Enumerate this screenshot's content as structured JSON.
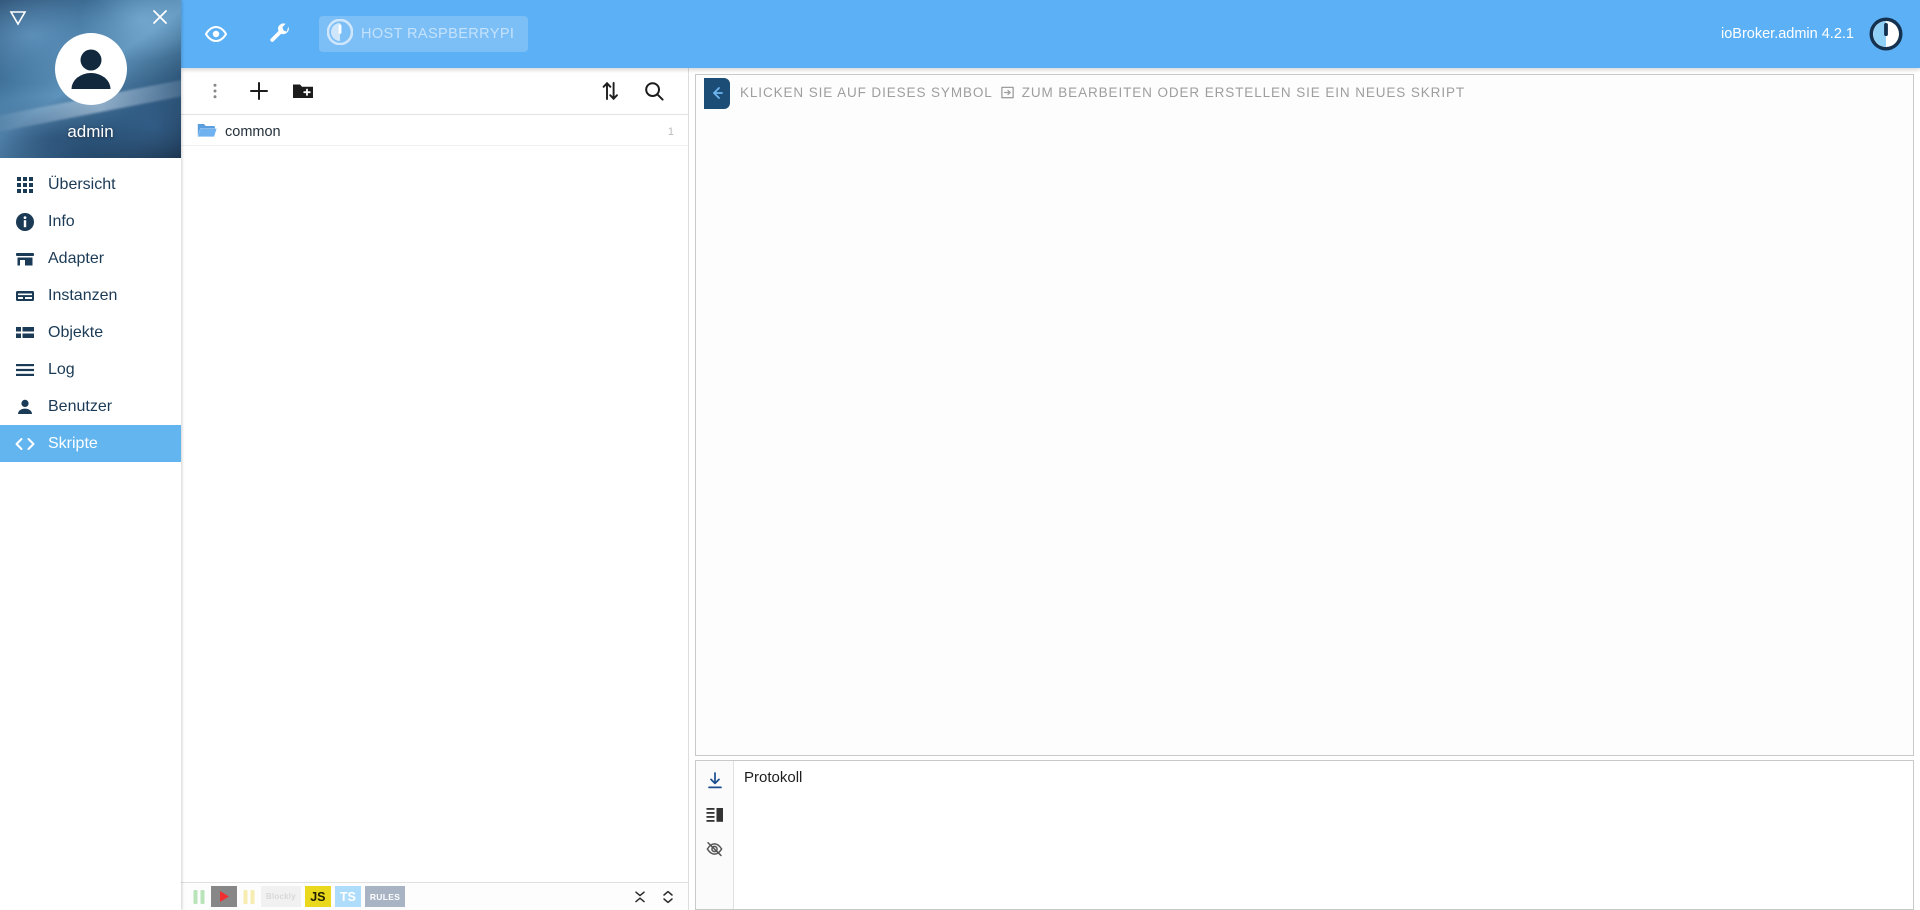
{
  "sidebar": {
    "username": "admin",
    "logo_icon": "iobroker-triangle-icon",
    "close_icon": "close-icon",
    "avatar_icon": "user-avatar-icon",
    "items": [
      {
        "label": "Übersicht",
        "icon": "apps-grid-icon",
        "active": false
      },
      {
        "label": "Info",
        "icon": "info-circle-icon",
        "active": false
      },
      {
        "label": "Adapter",
        "icon": "store-icon",
        "active": false
      },
      {
        "label": "Instanzen",
        "icon": "instances-icon",
        "active": false
      },
      {
        "label": "Objekte",
        "icon": "objects-list-icon",
        "active": false
      },
      {
        "label": "Log",
        "icon": "log-lines-icon",
        "active": false
      },
      {
        "label": "Benutzer",
        "icon": "person-icon",
        "active": false
      },
      {
        "label": "Skripte",
        "icon": "code-brackets-icon",
        "active": true
      }
    ]
  },
  "appbar": {
    "eye_icon": "eye-icon",
    "wrench_icon": "wrench-icon",
    "host_chip": {
      "label": "HOST RASPBERRYPI",
      "icon": "iobroker-logo-icon"
    },
    "version": "ioBroker.admin 4.2.1",
    "logo_icon": "iobroker-logo-icon"
  },
  "scripts_panel": {
    "toolbar": [
      {
        "name": "more-menu",
        "icon": "dots-vertical-icon"
      },
      {
        "name": "add-script",
        "icon": "plus-icon"
      },
      {
        "name": "new-folder",
        "icon": "folder-plus-icon"
      },
      {
        "name": "sort",
        "icon": "sort-arrows-icon"
      },
      {
        "name": "search",
        "icon": "search-icon"
      }
    ],
    "tree": [
      {
        "name": "common",
        "count": "1",
        "icon": "folder-open-icon"
      }
    ],
    "footer_filters": [
      {
        "name": "filter-paused-green",
        "icon": "pause-bars-green-icon",
        "label": ""
      },
      {
        "name": "filter-running",
        "icon": "play-triangle-icon",
        "label": ""
      },
      {
        "name": "filter-paused-yellow",
        "icon": "pause-bars-yellow-icon",
        "label": ""
      },
      {
        "name": "filter-blockly",
        "icon": "blockly-badge-icon",
        "label": "Blockly"
      },
      {
        "name": "filter-js",
        "icon": "js-badge-icon",
        "label": "JS"
      },
      {
        "name": "filter-ts",
        "icon": "ts-badge-icon",
        "label": "TS"
      },
      {
        "name": "filter-rules",
        "icon": "rules-badge-icon",
        "label": "RULES"
      }
    ],
    "footer_actions": [
      {
        "name": "collapse-all",
        "icon": "collapse-all-icon"
      },
      {
        "name": "expand-all",
        "icon": "expand-all-icon"
      }
    ]
  },
  "editor": {
    "back_tab_icon": "arrow-left-icon",
    "hint_prefix": "KLICKEN SIE AUF DIESES SYMBOL",
    "hint_icon": "open-in-editor-icon",
    "hint_suffix": "ZUM BEARBEITEN ODER ERSTELLEN SIE EIN NEUES SKRIPT"
  },
  "log": {
    "title": "Protokoll",
    "rail": [
      {
        "name": "scroll-to-bottom",
        "icon": "download-arrow-icon"
      },
      {
        "name": "layout-toggle",
        "icon": "split-layout-icon"
      },
      {
        "name": "hide-log",
        "icon": "eye-off-icon"
      }
    ]
  },
  "colors": {
    "appbar_blue": "#5cb0f5",
    "active_item_blue": "#62b5ef",
    "sidebar_text": "#1b3a55",
    "tab_navy": "#1b4d77",
    "hint_gray": "#9e9e9e"
  }
}
